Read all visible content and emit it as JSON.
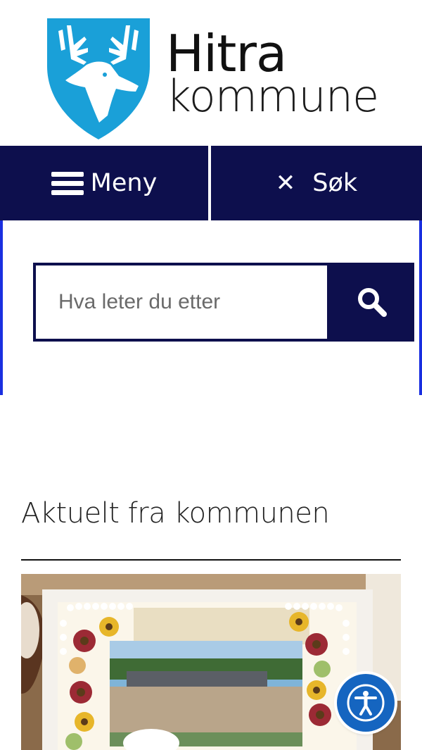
{
  "header": {
    "logo_icon": "deer-crest-icon",
    "brand_line1": "Hitra",
    "brand_line2": "kommune"
  },
  "nav": {
    "menu_icon": "hamburger-icon",
    "menu_label": "Meny",
    "search_toggle_icon": "close-icon",
    "search_label": "Søk"
  },
  "search": {
    "placeholder": "Hva leter du etter",
    "value": "",
    "submit_icon": "search-icon"
  },
  "main": {
    "section_title": "Aktuelt fra kommunen"
  },
  "news": {
    "image_icon": "news-photo"
  },
  "accessibility": {
    "icon": "accessibility-icon"
  },
  "colors": {
    "nav_bg": "#0d0f4d",
    "accent_border": "#1a2fe0",
    "logo_blue": "#1aa0d8",
    "a11y_blue": "#1565c0"
  }
}
